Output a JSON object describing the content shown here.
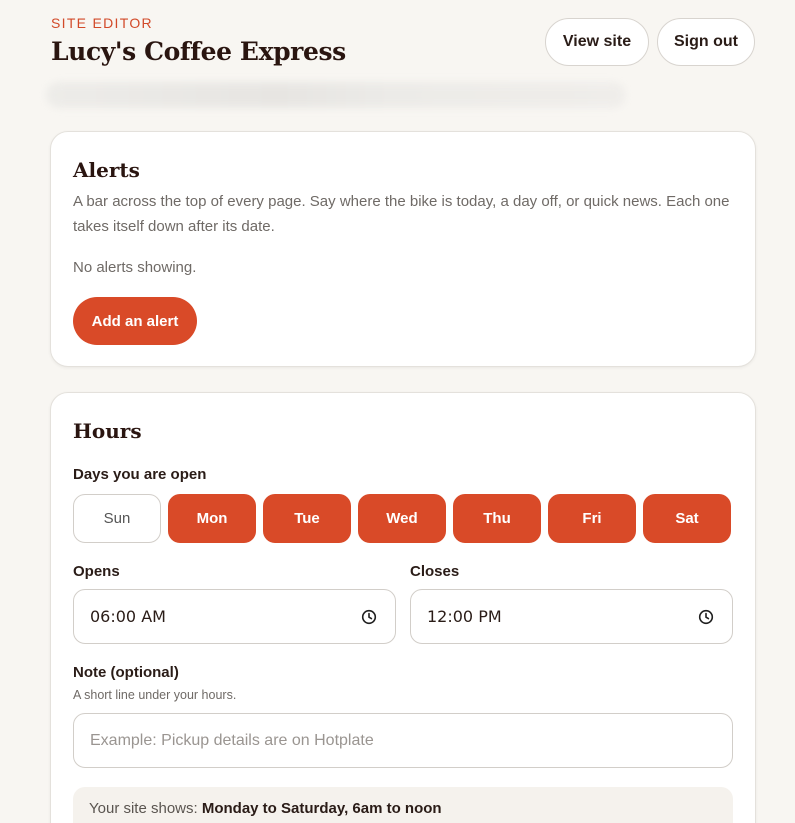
{
  "header": {
    "eyebrow": "SITE EDITOR",
    "title": "Lucy's Coffee Express",
    "view_site_label": "View site",
    "sign_out_label": "Sign out"
  },
  "alerts": {
    "title": "Alerts",
    "description": "A bar across the top of every page. Say where the bike is today, a day off, or quick news. Each one takes itself down after its date.",
    "empty_text": "No alerts showing.",
    "add_label": "Add an alert"
  },
  "hours": {
    "title": "Hours",
    "days_label": "Days you are open",
    "days": [
      {
        "label": "Sun",
        "selected": false
      },
      {
        "label": "Mon",
        "selected": true
      },
      {
        "label": "Tue",
        "selected": true
      },
      {
        "label": "Wed",
        "selected": true
      },
      {
        "label": "Thu",
        "selected": true
      },
      {
        "label": "Fri",
        "selected": true
      },
      {
        "label": "Sat",
        "selected": true
      }
    ],
    "opens_label": "Opens",
    "opens_value": "06:00 AM",
    "closes_label": "Closes",
    "closes_value": "12:00 PM",
    "note_label": "Note (optional)",
    "note_hint": "A short line under your hours.",
    "note_placeholder": "Example: Pickup details are on Hotplate",
    "note_value": "",
    "preview_prefix": "Your site shows:",
    "preview_value": "Monday to Saturday, 6am to noon"
  },
  "colors": {
    "accent": "#d94a28",
    "background": "#f8f6f2"
  }
}
